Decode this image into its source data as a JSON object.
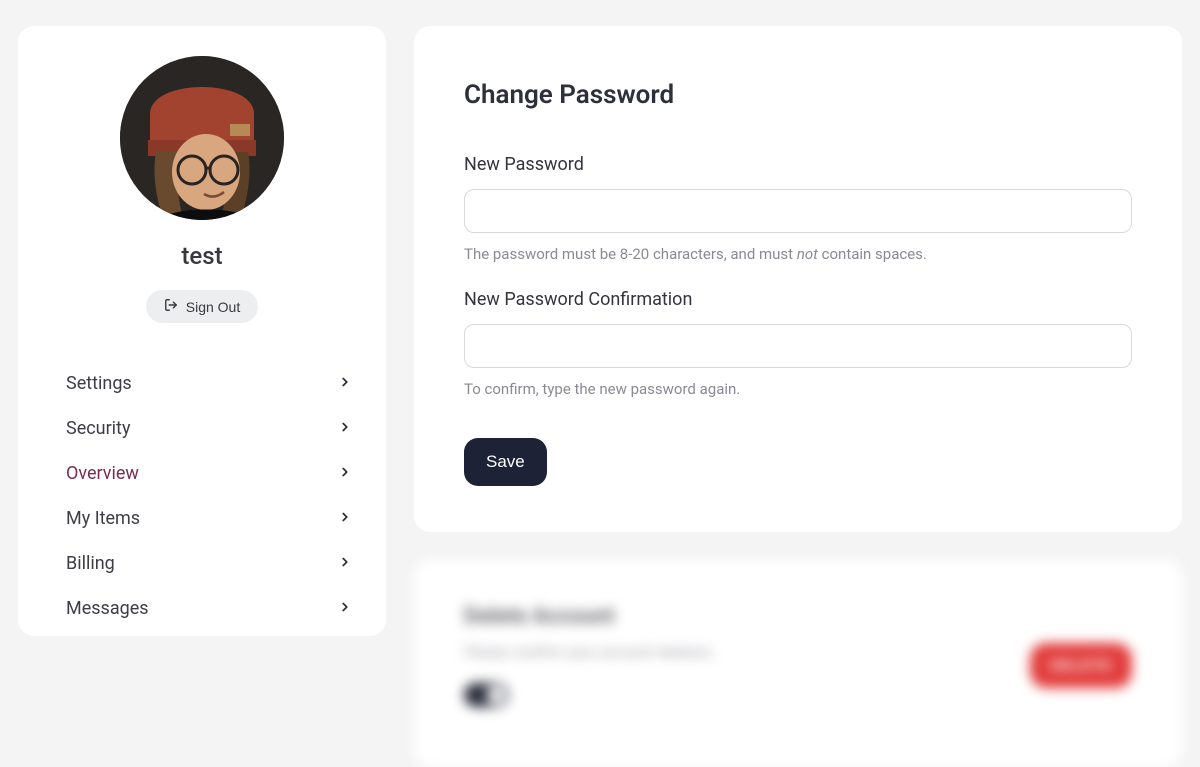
{
  "sidebar": {
    "username": "test",
    "signout_label": "Sign Out",
    "nav": [
      {
        "label": "Settings",
        "active": false
      },
      {
        "label": "Security",
        "active": false
      },
      {
        "label": "Overview",
        "active": true
      },
      {
        "label": "My Items",
        "active": false
      },
      {
        "label": "Billing",
        "active": false
      },
      {
        "label": "Messages",
        "active": false
      }
    ]
  },
  "password_card": {
    "title": "Change Password",
    "new_pw_label": "New Password",
    "new_pw_help_prefix": "The password must be 8-20 characters, and must ",
    "new_pw_help_em": "not",
    "new_pw_help_suffix": " contain spaces.",
    "confirm_label": "New Password Confirmation",
    "confirm_help": "To confirm, type the new password again.",
    "save_label": "Save"
  },
  "danger_card": {
    "title": "Delete Account",
    "subtitle": "Please confirm your account deletion.",
    "delete_label": "DELETE"
  }
}
